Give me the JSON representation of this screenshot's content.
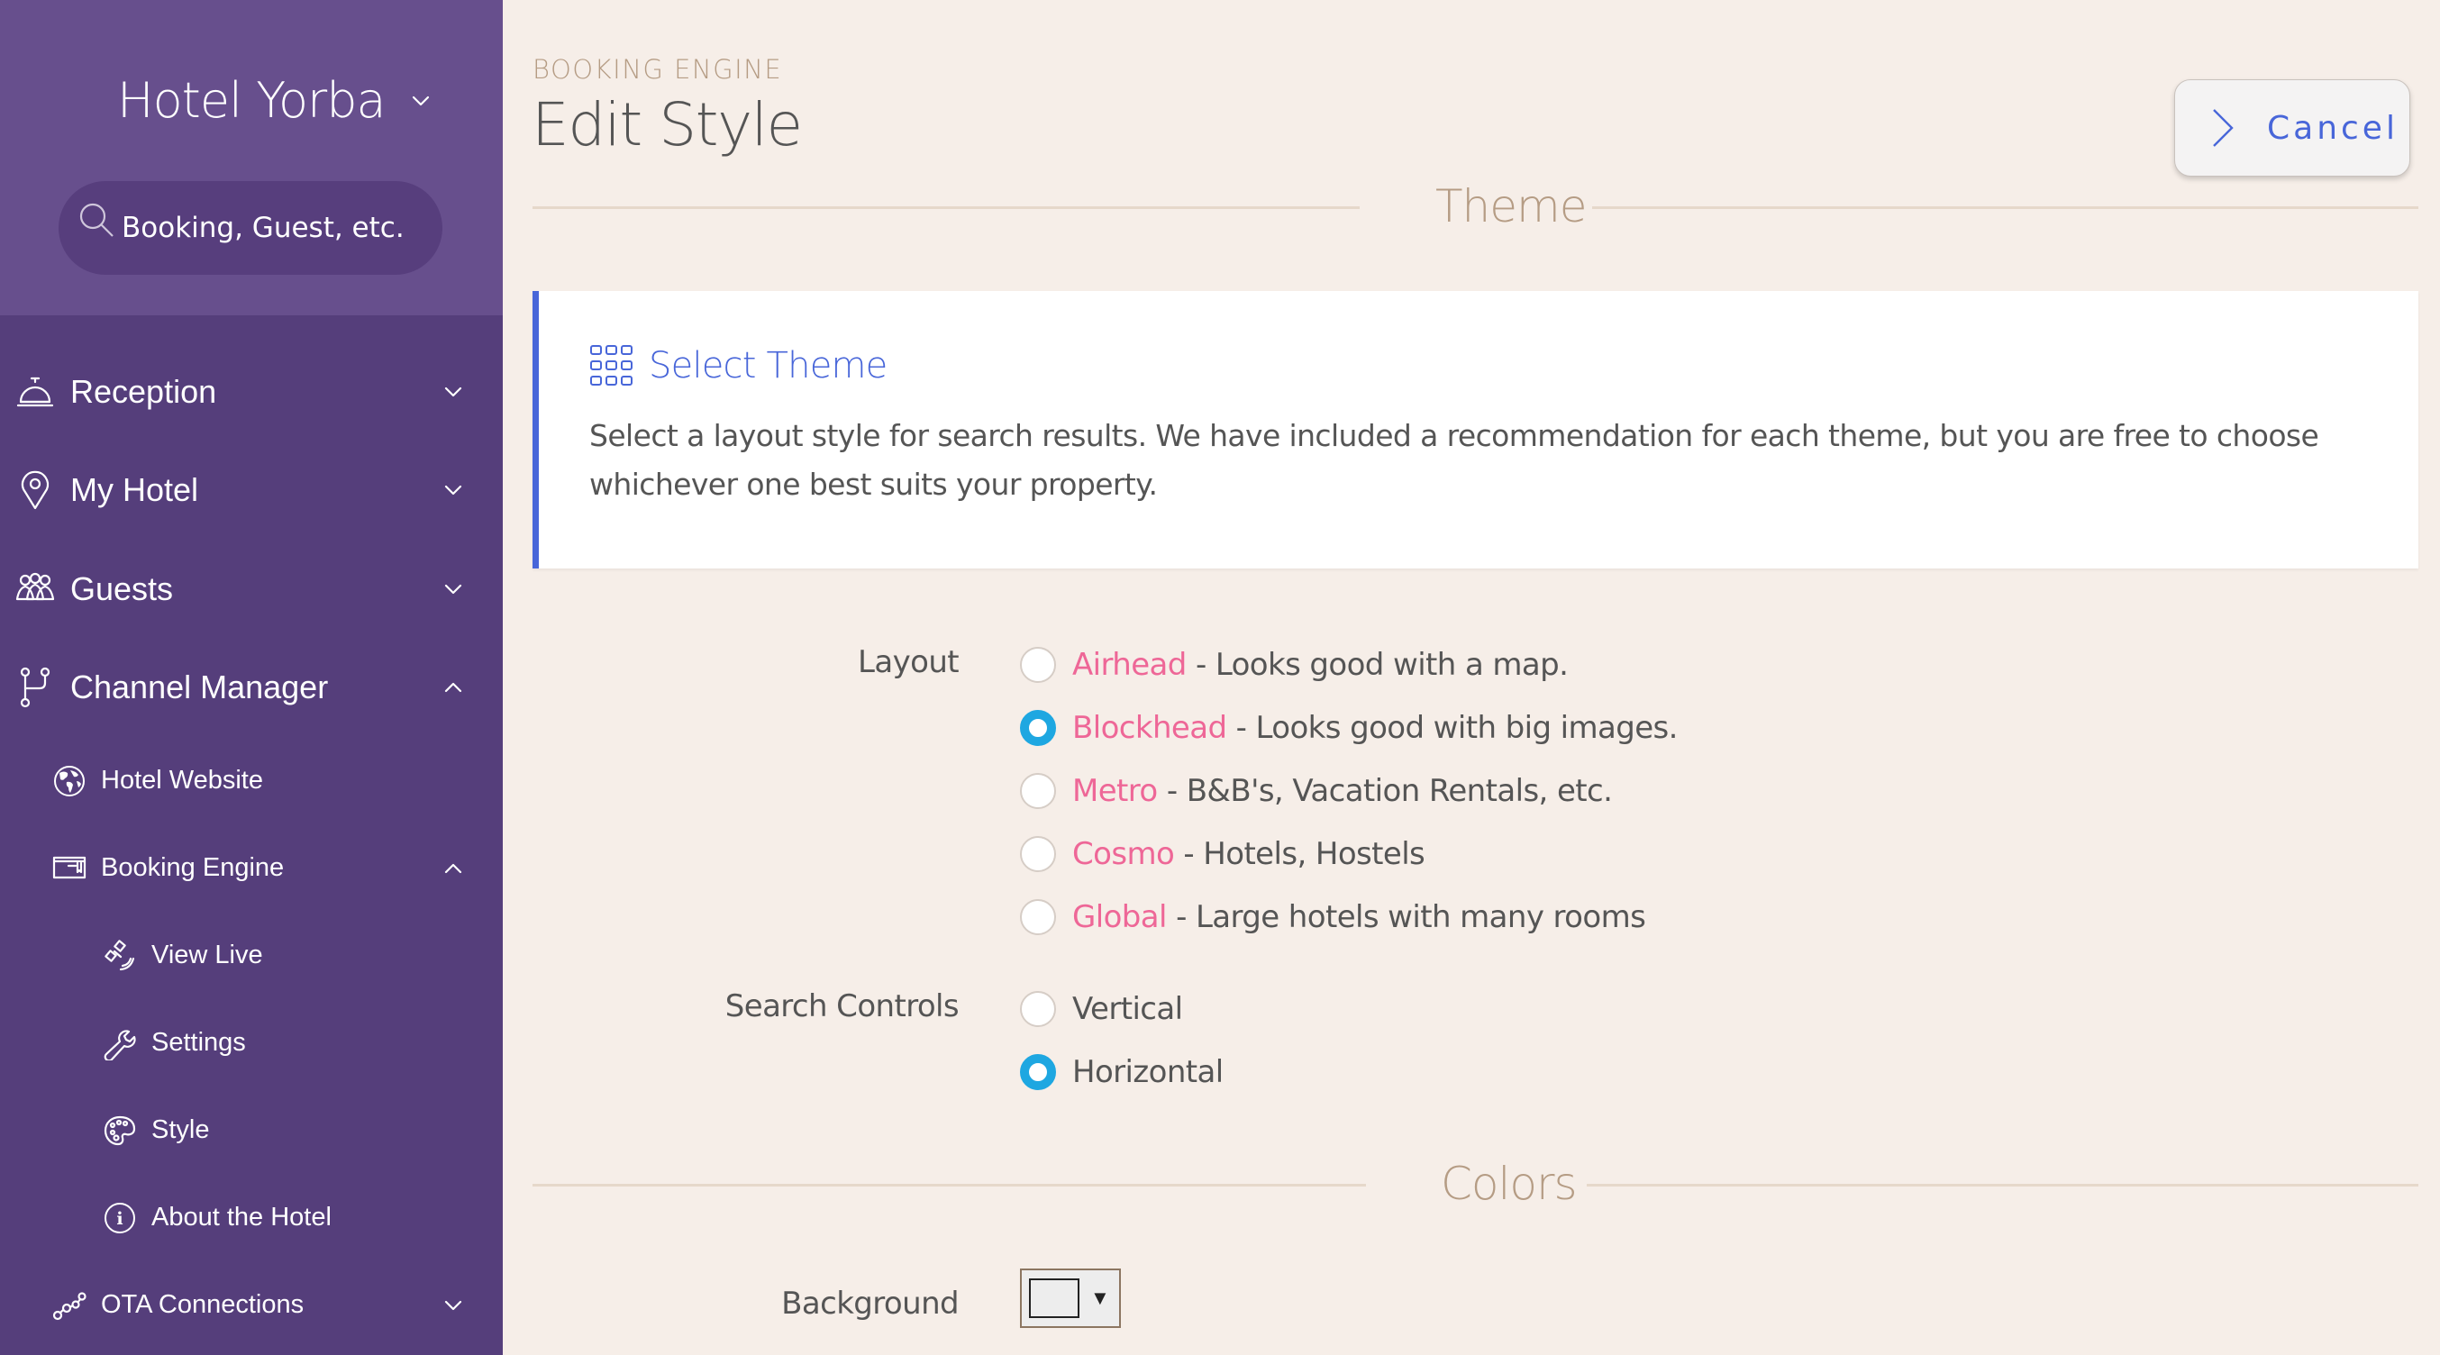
{
  "sidebar": {
    "hotel_name": "Hotel Yorba",
    "search_placeholder": "Booking, Guest, etc.",
    "items": [
      {
        "label": "Reception",
        "icon": "bell-icon",
        "expanded": false
      },
      {
        "label": "My Hotel",
        "icon": "map-pin-icon",
        "expanded": false
      },
      {
        "label": "Guests",
        "icon": "users-icon",
        "expanded": false
      },
      {
        "label": "Channel Manager",
        "icon": "branch-icon",
        "expanded": true,
        "children": [
          {
            "label": "Hotel Website",
            "icon": "globe-icon"
          },
          {
            "label": "Booking Engine",
            "icon": "browser-window-icon",
            "expanded": true,
            "children": [
              {
                "label": "View Live",
                "icon": "satellite-icon"
              },
              {
                "label": "Settings",
                "icon": "wrench-icon"
              },
              {
                "label": "Style",
                "icon": "palette-icon",
                "active": true
              },
              {
                "label": "About the Hotel",
                "icon": "info-icon"
              }
            ]
          },
          {
            "label": "OTA Connections",
            "icon": "nodes-icon",
            "expanded": false
          }
        ]
      }
    ]
  },
  "header": {
    "breadcrumb": "BOOKING ENGINE",
    "title": "Edit Style",
    "cancel_label": "Cancel"
  },
  "sections": {
    "theme_title": "Theme",
    "colors_title": "Colors"
  },
  "info": {
    "title": "Select Theme",
    "text": "Select a layout style for search results. We have included a recommendation for each theme, but you are free to choose whichever one best suits your property."
  },
  "layout": {
    "label": "Layout",
    "selected": "Blockhead",
    "options": [
      {
        "name": "Airhead",
        "desc": " - Looks good with a map.",
        "checked": false
      },
      {
        "name": "Blockhead",
        "desc": " - Looks good with big images.",
        "checked": true
      },
      {
        "name": "Metro",
        "desc": " - B&B's, Vacation Rentals, etc.",
        "checked": false
      },
      {
        "name": "Cosmo",
        "desc": " - Hotels, Hostels",
        "checked": false
      },
      {
        "name": "Global",
        "desc": " - Large hotels with many rooms",
        "checked": false
      }
    ]
  },
  "search_controls": {
    "label": "Search Controls",
    "selected": "Horizontal",
    "options": [
      {
        "name": "Vertical",
        "checked": false
      },
      {
        "name": "Horizontal",
        "checked": true
      }
    ]
  },
  "colors": {
    "background_label": "Background",
    "background_value": "#ededed"
  },
  "theme_colors": {
    "sidebar_bg": "#553e7b",
    "sidebar_header_bg": "#674f8d",
    "page_bg": "#f6eee8",
    "accent_blue": "#4866d9",
    "radio_selected": "#1ea7e1",
    "theme_name_pink": "#ee6797",
    "section_tan": "#b59c84"
  }
}
